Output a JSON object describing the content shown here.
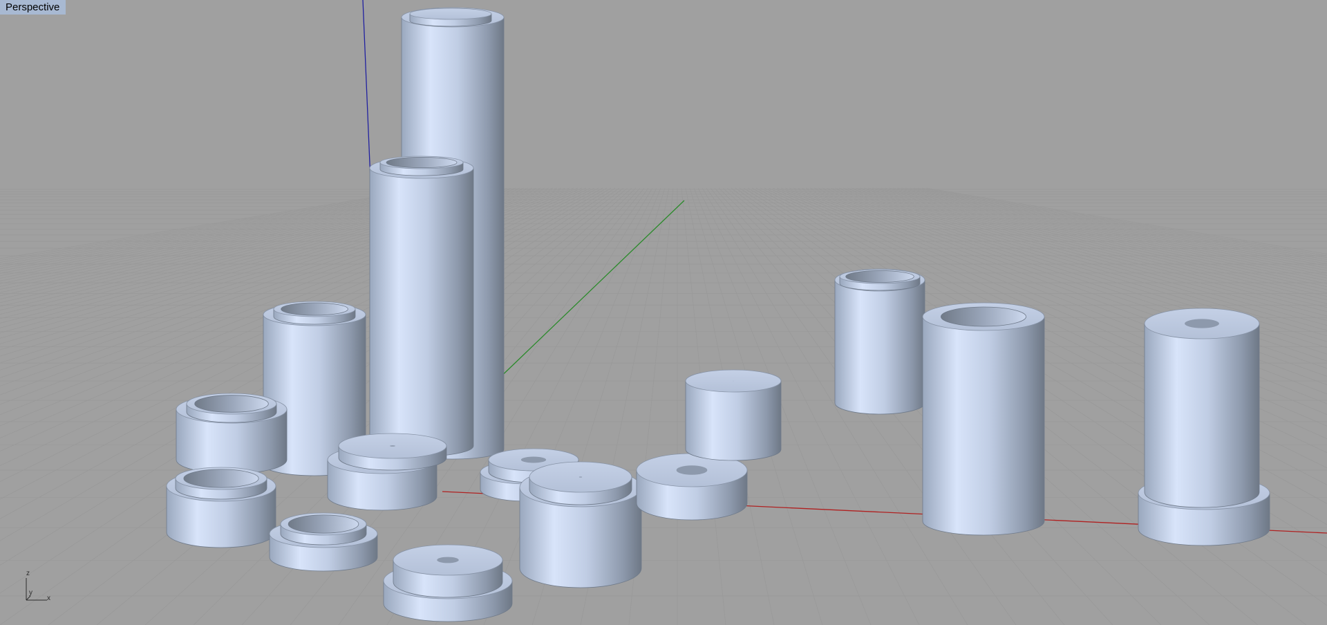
{
  "viewport": {
    "label": "Perspective",
    "axis_labels": {
      "z": "z",
      "y": "y",
      "x": "x"
    }
  },
  "colors": {
    "background": "#a0a0a0",
    "grid": "#999999",
    "x_axis": "#b02020",
    "y_axis": "#2a8a2a",
    "z_axis": "#2020a0",
    "object_light": "#d6e2f8",
    "object_mid": "#a8b6cc",
    "object_dark": "#7e8a9c",
    "label_background": "#a8b9d2"
  },
  "icons": [
    "world-axes-icon"
  ]
}
